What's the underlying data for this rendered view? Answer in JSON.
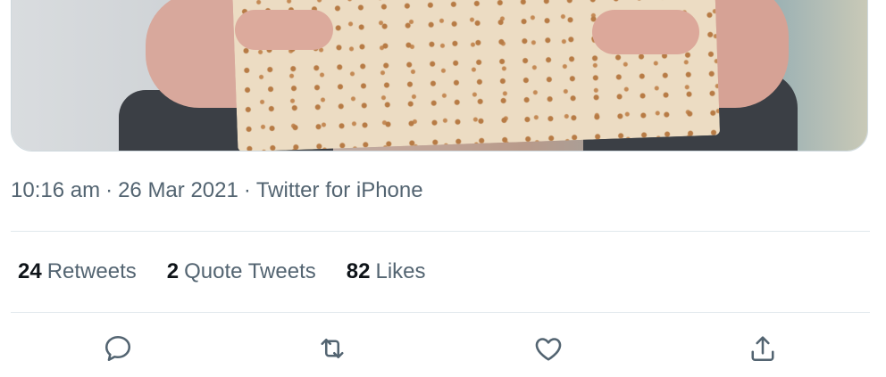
{
  "tweet": {
    "media": {
      "icon": "photo-matzah"
    },
    "meta": {
      "time": "10:16 am",
      "separator": "·",
      "date": "26 Mar 2021",
      "source": "Twitter for iPhone"
    },
    "stats": {
      "retweets": {
        "count": "24",
        "label": "Retweets"
      },
      "quotes": {
        "count": "2",
        "label": "Quote Tweets"
      },
      "likes": {
        "count": "82",
        "label": "Likes"
      }
    },
    "actions": {
      "reply_icon": "reply-icon",
      "retweet_icon": "retweet-icon",
      "like_icon": "like-icon",
      "share_icon": "share-icon",
      "icon_color": "#536471"
    }
  }
}
